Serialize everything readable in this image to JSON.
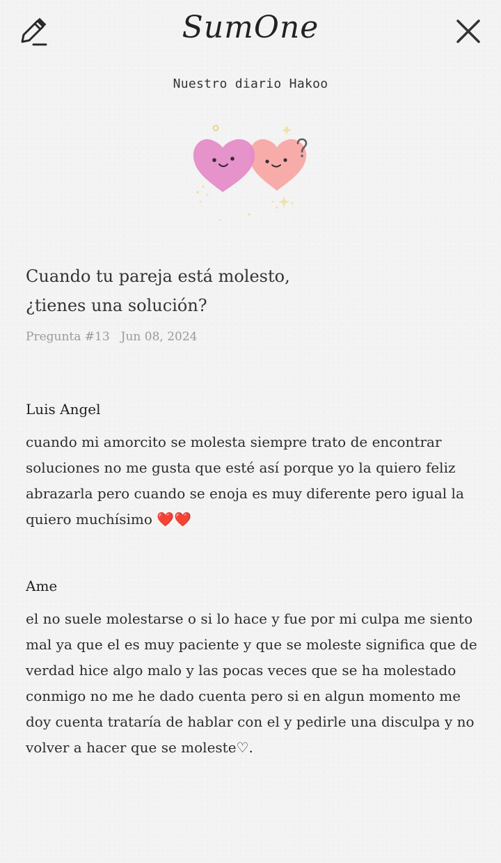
{
  "header": {
    "logo": "SumOne",
    "subtitle": "Nuestro diario Hakoo",
    "edit_icon": "pencil-edit-icon",
    "close_icon": "close-icon"
  },
  "question": {
    "line1": "Cuando tu pareja está molesto,",
    "line2": "¿tienes una solución?",
    "number": "Pregunta #13",
    "date": "Jun 08, 2024"
  },
  "answers": [
    {
      "name": "Luis Angel",
      "text": "cuando mi amorcito se molesta siempre trato de encontrar soluciones no me gusta que esté así porque yo la quiero feliz abrazarla pero cuando se enoja es muy diferente pero igual la quiero muchísimo ❤️❤️"
    },
    {
      "name": "Ame",
      "text": "el no suele molestarse o si lo hace y fue por mi culpa me siento mal ya que el es muy paciente y que se moleste significa que de verdad hice algo malo y las pocas veces que se ha molestado conmigo no me he dado cuenta pero si en algun momento me doy cuenta trataría de hablar con el y pedirle una disculpa y no volver a hacer que se moleste♡."
    }
  ],
  "colors": {
    "background": "#f3f3f3",
    "heart_left": "#e58cc8",
    "heart_right": "#f8a8a4",
    "meta_text": "#9a9a9a"
  }
}
